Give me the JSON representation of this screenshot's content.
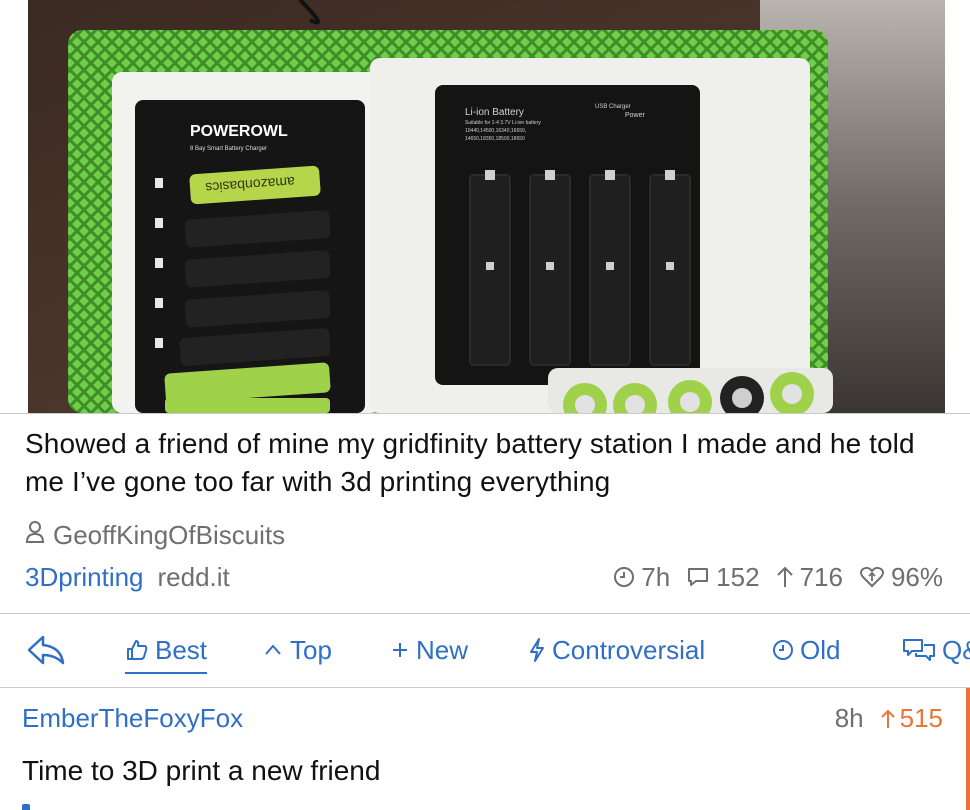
{
  "post": {
    "title": "Showed a friend of mine my gridfinity battery station I made and he told me I’ve gone too far with 3d printing everything",
    "author": "GeoffKingOfBiscuits",
    "subreddit": "3Dprinting",
    "domain": "redd.it",
    "age": "7h",
    "comments": "152",
    "upvotes": "716",
    "upvote_ratio": "96%",
    "image": {
      "charger_left_brand": "POWEROWL",
      "charger_left_sub": "8 Bay Smart Battery Charger",
      "battery_label": "amazonbasics",
      "charger_right_title": "Li-ion Battery",
      "charger_right_usb": "USB Charger",
      "charger_right_power": "Power",
      "charger_right_line1": "Suitable for 1-4 3.7V Li-ion battery",
      "charger_right_line2": "10440,14500,16340,16650,",
      "charger_right_line3": "14650,18350,18500,18650"
    }
  },
  "sort": {
    "back": "",
    "best": "Best",
    "top": "Top",
    "new": "New",
    "controversial": "Controversial",
    "old": "Old",
    "qa": "Q&A"
  },
  "comment": {
    "author": "EmberTheFoxyFox",
    "age": "8h",
    "score": "515",
    "body": "Time to 3D print a new friend"
  },
  "colors": {
    "link": "#2f6fc6",
    "upvote": "#e8753a",
    "meta": "#6e6e73",
    "basket": "#7ed957"
  }
}
